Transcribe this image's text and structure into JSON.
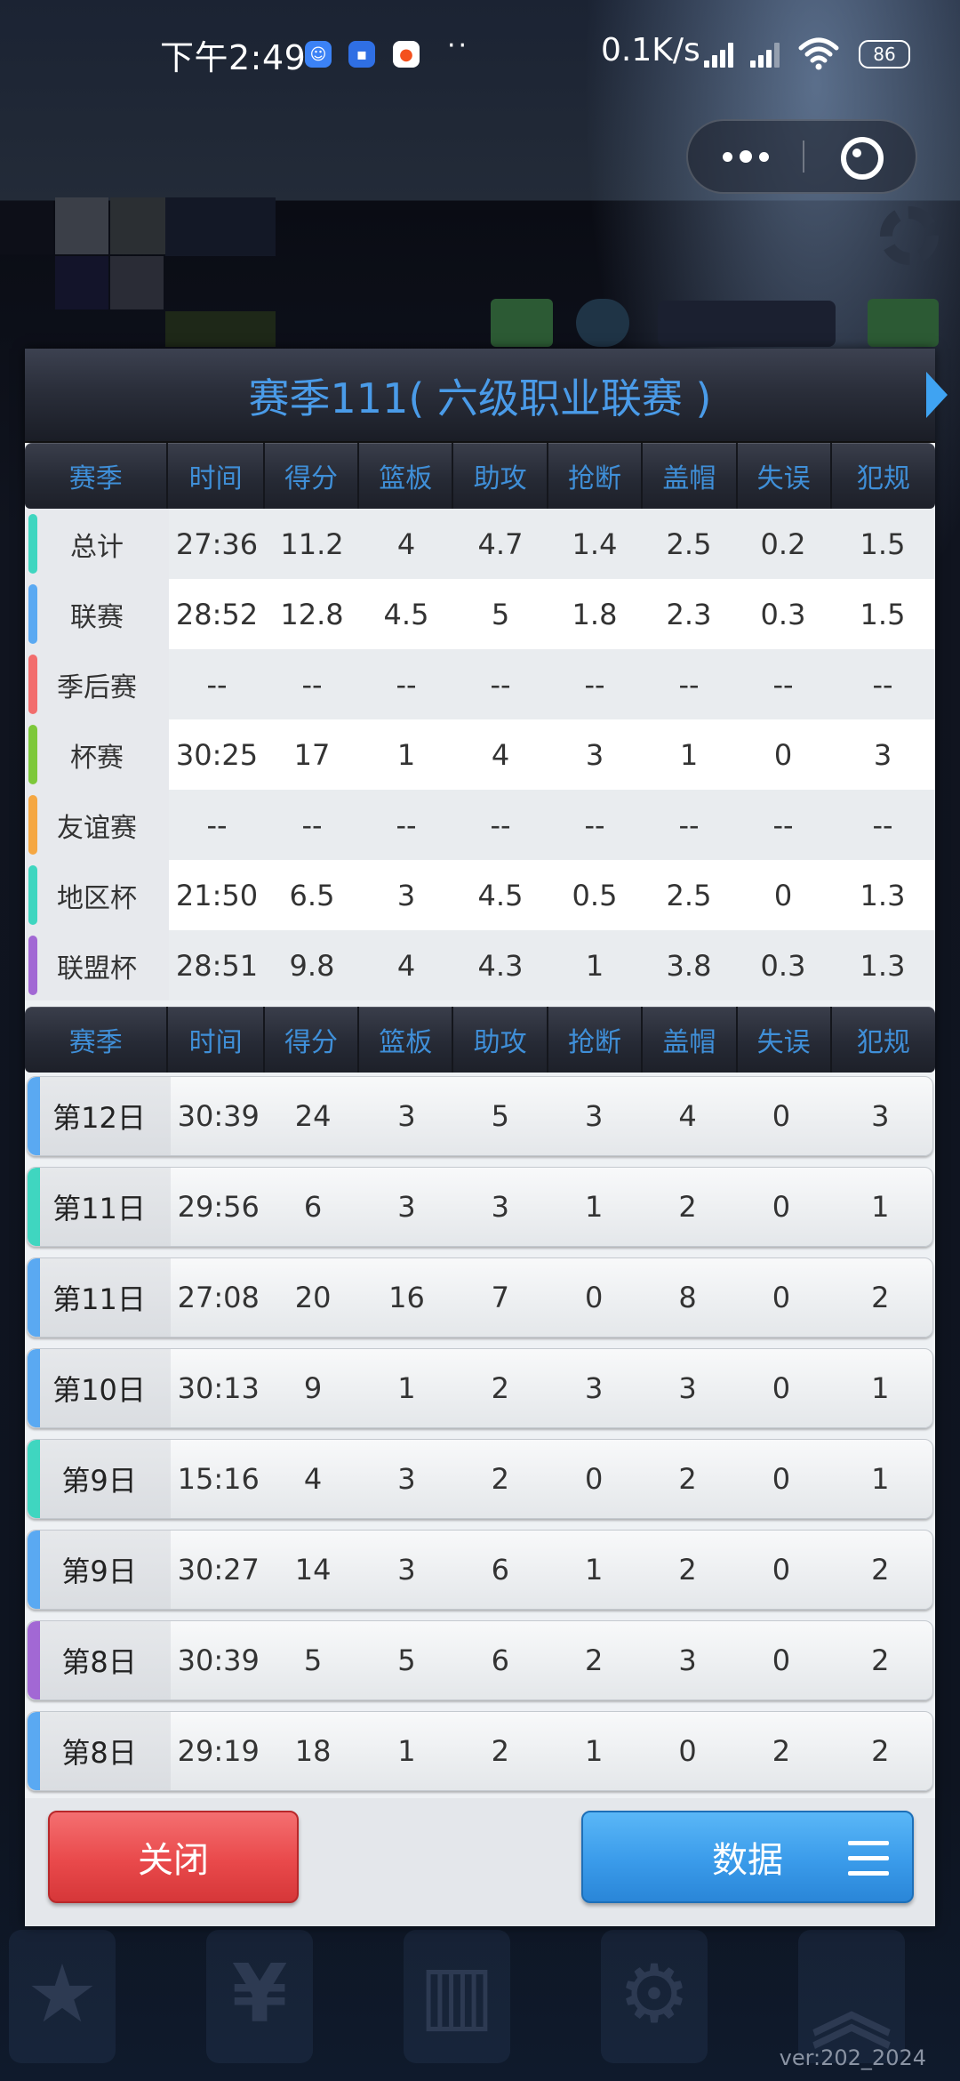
{
  "status_bar": {
    "time": "下午2:49",
    "apps": [
      {
        "icon": "app-icon-blue",
        "color": "#3b82f6"
      },
      {
        "icon": "app-icon-blue-square",
        "color": "#2f6fe4"
      },
      {
        "icon": "app-icon-orange",
        "color": "#f4511e"
      }
    ],
    "more": "··",
    "net_speed": "0.1K/s",
    "battery": "86"
  },
  "dialog": {
    "title": "赛季111( 六级职业联赛 )",
    "columns": [
      "赛季",
      "时间",
      "得分",
      "篮板",
      "助攻",
      "抢断",
      "盖帽",
      "失误",
      "犯规"
    ],
    "summary_rows": [
      {
        "label": "总计",
        "color": "#3fd6c0",
        "values": [
          "27:36",
          "11.2",
          "4",
          "4.7",
          "1.4",
          "2.5",
          "0.2",
          "1.5"
        ]
      },
      {
        "label": "联赛",
        "color": "#5aa9f2",
        "values": [
          "28:52",
          "12.8",
          "4.5",
          "5",
          "1.8",
          "2.3",
          "0.3",
          "1.5"
        ]
      },
      {
        "label": "季后赛",
        "color": "#f26d6d",
        "values": [
          "--",
          "--",
          "--",
          "--",
          "--",
          "--",
          "--",
          "--"
        ]
      },
      {
        "label": "杯赛",
        "color": "#7dc83a",
        "values": [
          "30:25",
          "17",
          "1",
          "4",
          "3",
          "1",
          "0",
          "3"
        ]
      },
      {
        "label": "友谊赛",
        "color": "#f5a742",
        "values": [
          "--",
          "--",
          "--",
          "--",
          "--",
          "--",
          "--",
          "--"
        ]
      },
      {
        "label": "地区杯",
        "color": "#3fd6c0",
        "values": [
          "21:50",
          "6.5",
          "3",
          "4.5",
          "0.5",
          "2.5",
          "0",
          "1.3"
        ]
      },
      {
        "label": "联盟杯",
        "color": "#a268d4",
        "values": [
          "28:51",
          "9.8",
          "4",
          "4.3",
          "1",
          "3.8",
          "0.3",
          "1.3"
        ]
      }
    ],
    "game_rows": [
      {
        "label": "第12日",
        "color": "#5aa9f2",
        "values": [
          "30:39",
          "24",
          "3",
          "5",
          "3",
          "4",
          "0",
          "3"
        ]
      },
      {
        "label": "第11日",
        "color": "#3fd6c0",
        "values": [
          "29:56",
          "6",
          "3",
          "3",
          "1",
          "2",
          "0",
          "1"
        ]
      },
      {
        "label": "第11日",
        "color": "#5aa9f2",
        "values": [
          "27:08",
          "20",
          "16",
          "7",
          "0",
          "8",
          "0",
          "2"
        ]
      },
      {
        "label": "第10日",
        "color": "#5aa9f2",
        "values": [
          "30:13",
          "9",
          "1",
          "2",
          "3",
          "3",
          "0",
          "1"
        ]
      },
      {
        "label": "第9日",
        "color": "#3fd6c0",
        "values": [
          "15:16",
          "4",
          "3",
          "2",
          "0",
          "2",
          "0",
          "1"
        ]
      },
      {
        "label": "第9日",
        "color": "#5aa9f2",
        "values": [
          "30:27",
          "14",
          "3",
          "6",
          "1",
          "2",
          "0",
          "2"
        ]
      },
      {
        "label": "第8日",
        "color": "#a268d4",
        "values": [
          "30:39",
          "5",
          "5",
          "6",
          "2",
          "3",
          "0",
          "2"
        ]
      },
      {
        "label": "第8日",
        "color": "#5aa9f2",
        "values": [
          "29:19",
          "18",
          "1",
          "2",
          "1",
          "0",
          "2",
          "2"
        ]
      }
    ],
    "close_label": "关闭",
    "data_label": "数据"
  },
  "version": "ver:202_2024"
}
